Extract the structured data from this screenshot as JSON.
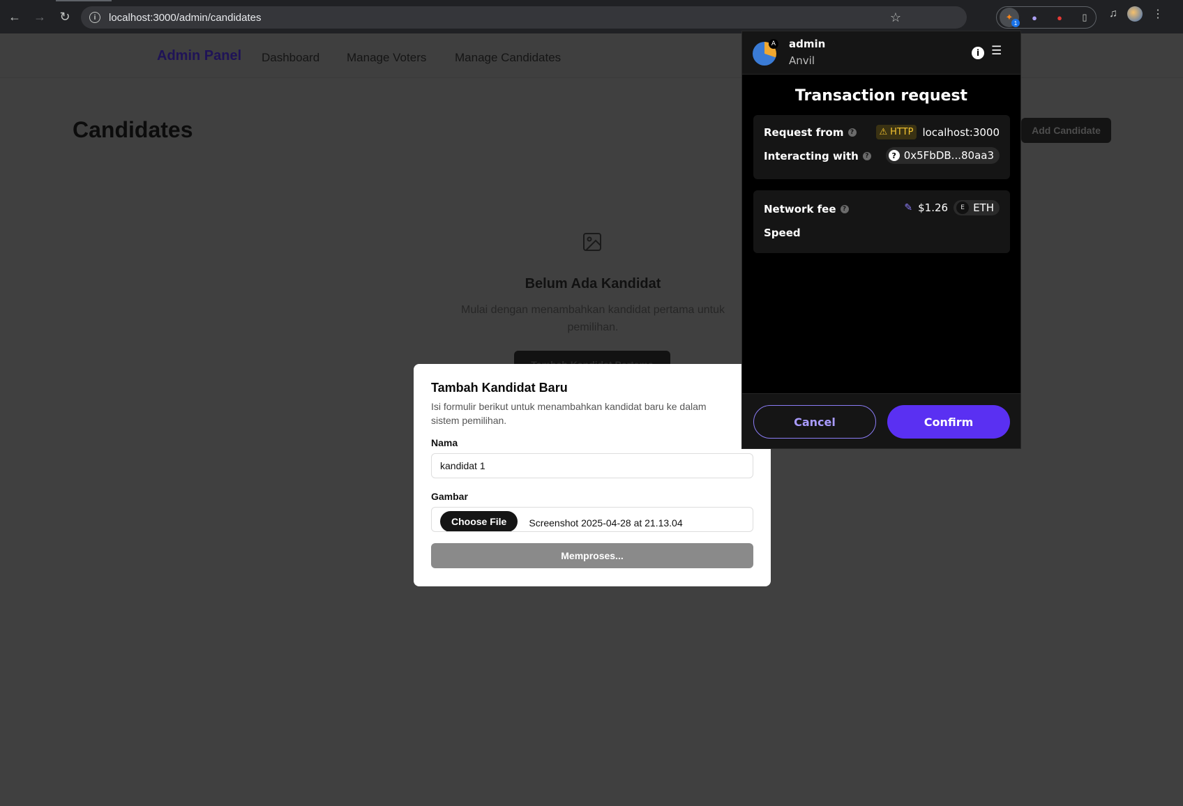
{
  "browser": {
    "url": "localhost:3000/admin/candidates",
    "ext_badge": "1"
  },
  "nav": {
    "brand": "Admin Panel",
    "links": [
      "Dashboard",
      "Manage Voters",
      "Manage Candidates"
    ]
  },
  "page": {
    "title": "Candidates",
    "add_button": "Add Candidate",
    "empty_title": "Belum Ada Kandidat",
    "empty_desc": "Mulai dengan menambahkan kandidat pertama untuk pemilihan.",
    "first_button": "Tambah Kandidat Pertama"
  },
  "modal": {
    "title": "Tambah Kandidat Baru",
    "desc": "Isi formulir berikut untuk menambahkan kandidat baru ke dalam sistem pemilihan.",
    "name_label": "Nama",
    "name_value": "kandidat 1",
    "image_label": "Gambar",
    "choose_file": "Choose File",
    "file_name": "Screenshot 2025-04-28 at 21.13.04",
    "submit": "Memproses..."
  },
  "wallet": {
    "avatar_letter": "A",
    "account": "admin",
    "network": "Anvil",
    "title": "Transaction request",
    "request_from_label": "Request from",
    "http_tag": "HTTP",
    "origin": "localhost:3000",
    "interacting_label": "Interacting with",
    "contract": "0x5FbDB...80aa3",
    "fee_label": "Network fee",
    "fee_value": "$1.26",
    "eth_letter": "E",
    "currency": "ETH",
    "speed_label": "Speed",
    "cancel": "Cancel",
    "confirm": "Confirm"
  }
}
